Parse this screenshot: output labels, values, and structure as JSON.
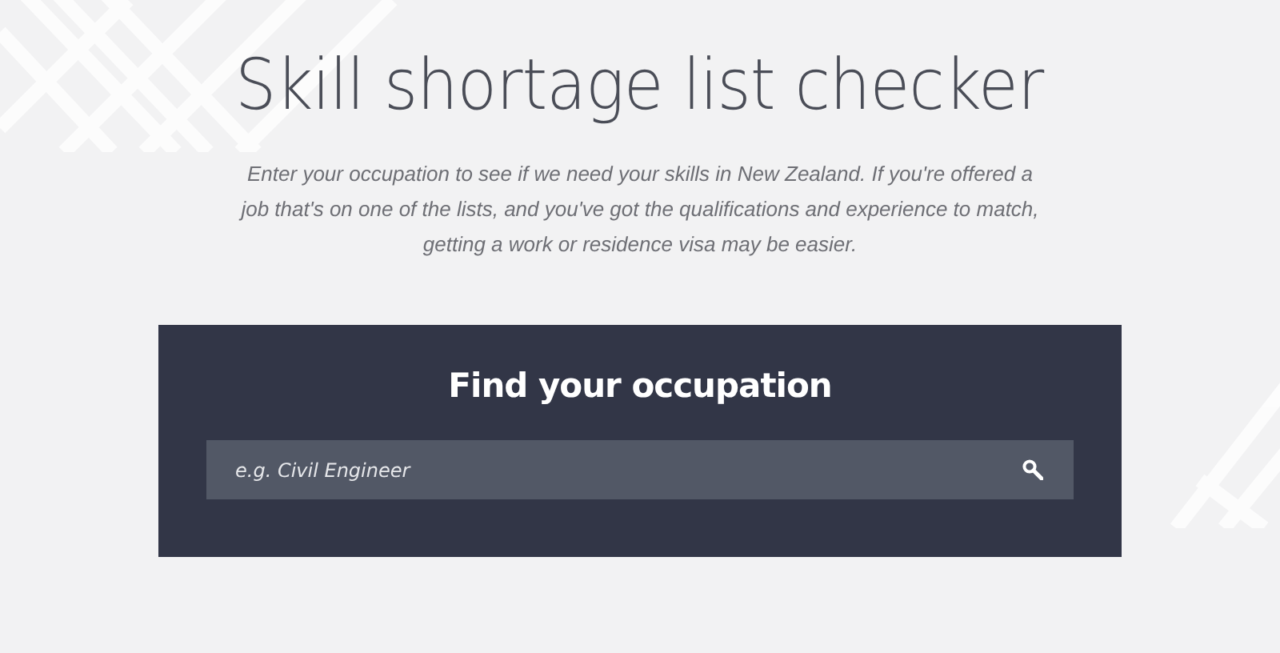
{
  "title": "Skill shortage list checker",
  "intro": "Enter your occupation to see if we need your skills in New Zealand. If you're offered a job that's on one of the lists, and you've got the qualifications and experience to match, getting a work or residence visa may be easier.",
  "search_panel": {
    "heading": "Find your occupation",
    "search": {
      "placeholder": "e.g. Civil Engineer"
    }
  }
}
